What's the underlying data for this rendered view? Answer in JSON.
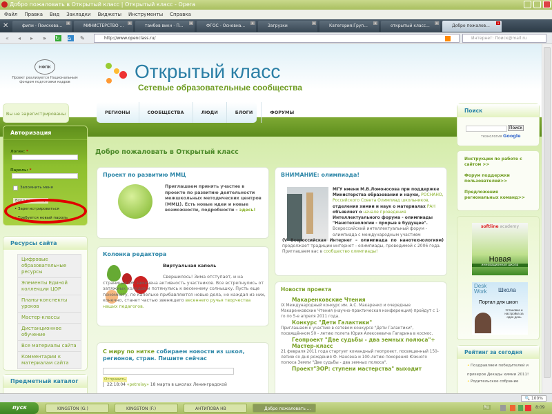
{
  "window": {
    "title": "Добро пожаловать в Открытый класс | Открытый класс - Opera"
  },
  "menu": [
    "Файл",
    "Правка",
    "Вид",
    "Закладки",
    "Виджеты",
    "Инструменты",
    "Справка"
  ],
  "tabs": [
    "фипи - Поисковa...",
    "МИНИСТЕРСТВО ...",
    "тамбов викн - П...",
    "ФГОС - Основна...",
    "Загрузки",
    "Категория:Груп...",
    "открытый класс...",
    "Добро пожалов..."
  ],
  "address": {
    "url": "http://www.openclass.ru/",
    "search_placeholder": "Интернет: Поиск@mail.ru"
  },
  "header": {
    "partner_logo": "НФПК",
    "partner_text": "Проект реализуется Национальным фондом подготовки кадров",
    "site_title": "Открытый класс",
    "site_subtitle": "Сетевые образовательные сообщества"
  },
  "nav": [
    "РЕГИОНЫ",
    "СООБЩЕСТВА",
    "ЛЮДИ",
    "БЛОГИ",
    "ФОРУМЫ"
  ],
  "left": {
    "not_registered": "Вы не зарегистрированы",
    "auth": {
      "title": "Авторизация",
      "login_label": "Логин:",
      "password_label": "Пароль:",
      "required": "*",
      "remember": "Запомнить меня",
      "submit": "Вход в систему",
      "register": "Зарегистрироваться",
      "forgot": "Требуется новый пароль"
    },
    "resources": {
      "title": "Ресурсы сайта",
      "items": [
        "Цифровые образовательные ресурсы",
        "Элементы Единой коллекции ЦОР",
        "Планы-конспекты уроков",
        "Мастер-классы",
        "Дистанционное обучение",
        "Все материалы сайта",
        "Комментарии к материалам сайта"
      ]
    },
    "catalog_title": "Предметный каталог"
  },
  "main": {
    "welcome": "Добро пожаловать в Открытый класс",
    "mmc": {
      "title": "Проект по развитию ММЦ",
      "text": "Приглашаем принять участие в проекте по развитию деятельности межшкольных методических центров (ММЦ). Есть новые идеи и новые возможности, подробности –",
      "link": "здесь!"
    },
    "editor": {
      "title": "Колонка редактора",
      "subtitle": "Виртуальная капель",
      "text": "Свершилось! Зима отступает, и на страницах ОК замечена активность участников. Все встрепнулись от затяжных холодов и потянулись к весеннему солнышку. Пусть еще понемногу, по капельке прибавляются новые дела, но каждая из них, конечно, станет частью звенящего",
      "link": "весеннего ручья творчества наших педагогов."
    },
    "news_feed": {
      "title_green": "С миру по нитке",
      "title_blue": "собираем новости из школ, регионов, стран. Пишите сейчас",
      "send": "Отправить",
      "entry_time": "22:18:04",
      "entry_user": "«petrolay»",
      "entry_text": "18 марта в школах Ленинградской"
    },
    "olympiad": {
      "title": "ВНИМАНИЕ: олимпиада!",
      "p1_bold": "МГУ имени М.В.Ломоносова при поддержке Министерства образования и науки,",
      "l1": "РОСНАНО,",
      "l2": "Российского Совета Олимпиад школьников,",
      "p1b": "отделения химии и наук о материалах",
      "l3": "РАН",
      "p1c": "объявляет о",
      "l4": "начале проведения",
      "p1d": "Интеллектуального форума - олимпиады \"Нанотехнологии - прорыв в будущее\".",
      "p2": "Всероссийский интеллектуальный форум - олимпиада с международным участием",
      "p2b": "(V Всероссийская Интернет – олимпиада по нанотехнологиям)",
      "p2c": "продолжает традиции интернет - олимпиады, проводимой с 2006 года.",
      "p3": "Приглашаем вас в",
      "l5": "сообщество олимпиады!"
    },
    "news": {
      "title": "Новости проекта",
      "items": [
        {
          "h": "Макаренковские Чтения",
          "t": "IX Международный конкурс им. А.С. Макаренко и очередные Макаренковские Чтения (научно-практическая конференция) пройдут с 1-го по 5-е апреля 2011 года."
        },
        {
          "h": "Конкурс \"Дети Галактики\"",
          "t": "Приглашаем к участию в сетевом конкурсе \"Дети Галактики\", посвящённом 50 - летию полета Юрия Алексеевича Гагарина в космос."
        },
        {
          "h": "Геопроект \"Две судьбы - два земных полюса\"+ Мастер-класс",
          "t": "21 февраля 2011 года стартует командный геопроект, посвященный 150-летию со дня рождения Ф. Нансена и 100-летию покорения Южного полюса Земли \"Две судьбы - два земных полюса\"."
        },
        {
          "h": "Проект\"ЭОР: ступени мастерства\" выходит",
          "t": ""
        }
      ]
    }
  },
  "right": {
    "search": {
      "title": "Поиск",
      "button": "Поиск",
      "powered": "технология",
      "google": "Google"
    },
    "links": [
      "Инструкции по работе с сайтом >>",
      "Форум поддержки пользователей>>",
      "Предложения региональных команд>>"
    ],
    "ads": [
      {
        "brand": "softline",
        "brand2": "academy",
        "title": "Новая",
        "sub": "инновационная школа"
      },
      {
        "brand": "Desk Work",
        "title": "Школа",
        "sub": "Портал для школ",
        "sub2": "Установка и настройка за один день"
      }
    ],
    "rating": {
      "title": "Рейтинг за сегодня",
      "items": [
        "Поздравляем победителей и призеров Декады химии 2011!",
        "Родительское собрание"
      ]
    }
  },
  "status": {
    "zoom": "100%"
  },
  "taskbar": {
    "start": "пуск",
    "items": [
      "KINGSTON (G:)",
      "KINGSTON (F:)",
      "АНТИПОВА НВ",
      "Добро пожаловать ..."
    ],
    "lang": "RU",
    "time": "8:09"
  },
  "colors": {
    "accent_green": "#7aa126",
    "heading_blue": "#2e87a8",
    "highlight_red": "#e00000"
  }
}
